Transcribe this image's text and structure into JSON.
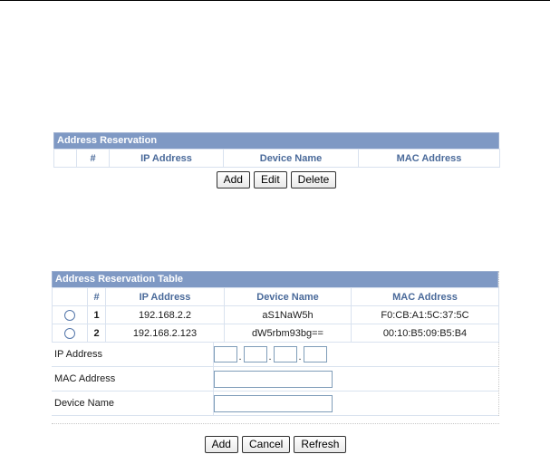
{
  "reservation": {
    "title": "Address Reservation",
    "columns": [
      "#",
      "IP Address",
      "Device Name",
      "MAC Address"
    ],
    "buttons": {
      "add": "Add",
      "edit": "Edit",
      "delete": "Delete"
    }
  },
  "reservation_table": {
    "title": "Address Reservation Table",
    "columns": [
      "#",
      "IP Address",
      "Device Name",
      "MAC Address"
    ],
    "rows": [
      {
        "num": "1",
        "ip": "192.168.2.2",
        "device": "aS1NaW5h",
        "mac": "F0:CB:A1:5C:37:5C"
      },
      {
        "num": "2",
        "ip": "192.168.2.123",
        "device": "dW5rbm93bg==",
        "mac": "00:10:B5:09:B5:B4"
      }
    ],
    "form": {
      "ip_label": "IP Address",
      "mac_label": "MAC Address",
      "device_label": "Device Name",
      "ip_dot": "."
    },
    "buttons": {
      "add": "Add",
      "cancel": "Cancel",
      "refresh": "Refresh"
    }
  }
}
